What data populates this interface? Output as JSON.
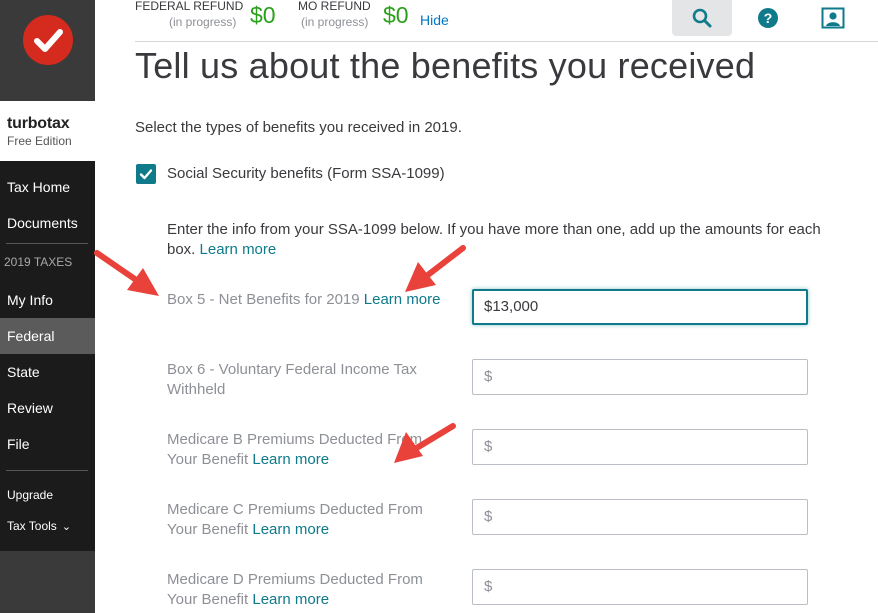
{
  "sidebar": {
    "brand": "turbotax",
    "edition": "Free Edition",
    "items": {
      "tax_home": "Tax Home",
      "documents": "Documents",
      "section_2019": "2019 TAXES",
      "my_info": "My Info",
      "federal": "Federal",
      "state": "State",
      "review": "Review",
      "file": "File",
      "upgrade": "Upgrade",
      "tax_tools": "Tax Tools"
    }
  },
  "header": {
    "federal_label": "FEDERAL REFUND",
    "federal_status": "(in progress)",
    "federal_amount": "$0",
    "mo_label": "MO REFUND",
    "mo_status": "(in progress)",
    "mo_amount": "$0",
    "hide": "Hide",
    "icons": [
      "search-icon",
      "help-icon",
      "account-icon"
    ]
  },
  "main": {
    "title": "Tell us about the benefits you received",
    "lead": "Select the types of benefits you received in 2019.",
    "checkbox_label": "Social Security benefits (Form SSA-1099)",
    "checkbox_checked": true,
    "info_text": "Enter the info from your SSA-1099 below. If you have more than one, add up the amounts for each box.",
    "learn_more": "Learn more",
    "fields": {
      "box5": {
        "label": "Box 5 - Net Benefits for 2019",
        "link": "Learn more",
        "value": "$13,000"
      },
      "box6": {
        "label": "Box 6 - Voluntary Federal Income Tax Withheld",
        "value": "$"
      },
      "medicare_b": {
        "label": "Medicare B Premiums Deducted From Your Benefit",
        "link": "Learn more",
        "value": "$"
      },
      "medicare_c": {
        "label": "Medicare C Premiums Deducted From Your Benefit",
        "link": "Learn more",
        "value": "$"
      },
      "medicare_d": {
        "label": "Medicare D Premiums Deducted From Your Benefit",
        "link": "Learn more",
        "value": "$"
      }
    }
  },
  "colors": {
    "accent": "#0e7a8a",
    "refund_green": "#2ca01c",
    "annotation_red": "#e8423a"
  }
}
